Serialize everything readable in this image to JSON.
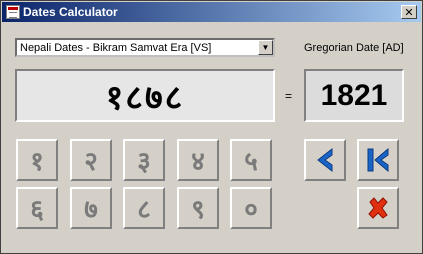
{
  "window": {
    "title": "Dates Calculator",
    "close_glyph": "✕"
  },
  "source": {
    "selected": "Nepali Dates - Bikram Samvat Era [VS]",
    "dropdown_glyph": "▼"
  },
  "target": {
    "label": "Gregorian Date [AD]"
  },
  "display": {
    "nepali_value": "१८७८",
    "equals": "=",
    "gregorian_value": "1821"
  },
  "keypad": {
    "row1": [
      "१",
      "२",
      "३",
      "४",
      "५"
    ],
    "row2": [
      "६",
      "७",
      "८",
      "९",
      "०"
    ]
  },
  "icons": {
    "back": "chevron-left-icon",
    "clear": "skip-to-start-icon",
    "close": "x-mark-icon"
  },
  "colors": {
    "accent_blue": "#1a64c8",
    "close_red": "#e03010",
    "digit_gray": "#7a7a7a"
  }
}
